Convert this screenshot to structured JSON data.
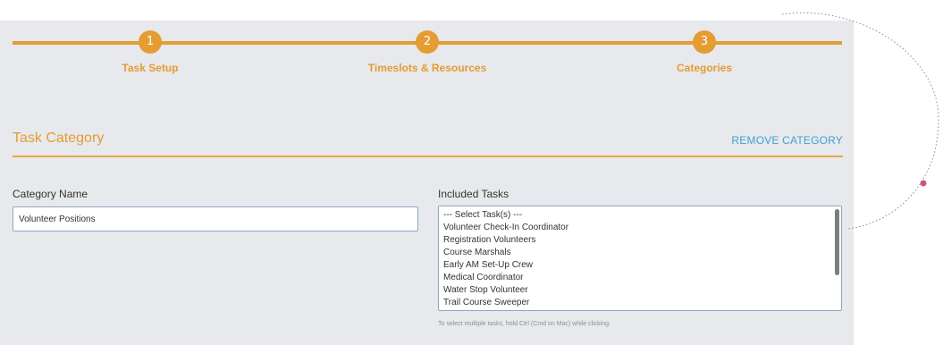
{
  "stepper": {
    "steps": [
      {
        "number": "1",
        "label": "Task Setup"
      },
      {
        "number": "2",
        "label": "Timeslots & Resources"
      },
      {
        "number": "3",
        "label": "Categories"
      }
    ]
  },
  "section": {
    "title": "Task Category",
    "remove_label": "REMOVE CATEGORY"
  },
  "form": {
    "category_name_label": "Category Name",
    "category_name_value": "Volunteer Positions",
    "included_tasks_label": "Included Tasks",
    "included_tasks_options": [
      "--- Select Task(s) ---",
      "Volunteer Check-In Coordinator",
      "Registration Volunteers",
      "Course Marshals",
      "Early AM Set-Up Crew",
      "Medical Coordinator",
      "Water Stop Volunteer",
      "Trail Course Sweeper"
    ],
    "hint": "To select multiple tasks, hold Ctrl (Cmd on Mac) while clicking."
  },
  "colors": {
    "accent": "#e49c33",
    "link": "#3fa0d3",
    "panel_background": "#e7e9ec",
    "decoration_dot": "#c95776"
  }
}
